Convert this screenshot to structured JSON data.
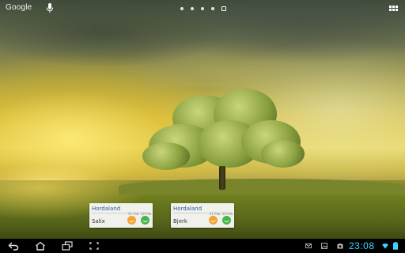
{
  "search": {
    "label": "Google"
  },
  "homescreen": {
    "pages": 5,
    "current_page": 5
  },
  "widgets": [
    {
      "region": "Hordaland",
      "location": "Salix",
      "col1": "21.Feb",
      "col2": "22.Feb",
      "status1_color": "#f2a431",
      "status2_color": "#46b54a"
    },
    {
      "region": "Hordaland",
      "location": "Bjerk",
      "col1": "21.Feb",
      "col2": "22.Feb",
      "status1_color": "#f2a431",
      "status2_color": "#46b54a"
    }
  ],
  "system": {
    "time": "23:08",
    "accent": "#3dd4ff"
  },
  "icons": {
    "mic": "microphone-icon",
    "apps": "all-apps-icon",
    "back": "back-icon",
    "home": "home-icon",
    "recents": "recent-apps-icon",
    "screenshot": "screenshot-icon"
  }
}
